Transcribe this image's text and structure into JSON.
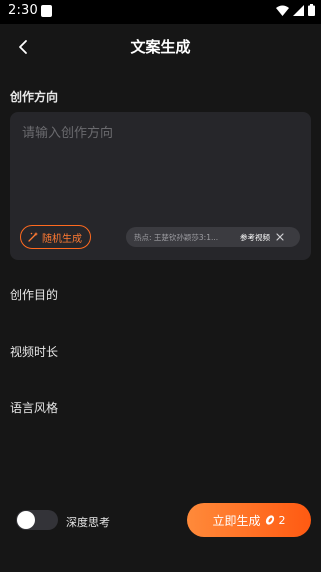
{
  "status": {
    "time": "2:30"
  },
  "header": {
    "title": "文案生成",
    "back_icon": "chevron-left-icon"
  },
  "direction": {
    "label": "创作方向",
    "placeholder": "请输入创作方向",
    "random_button": "随机生成",
    "hot_text": "热点: 王楚钦孙颖莎3:1...",
    "reference_video": "参考视频"
  },
  "fields": {
    "purpose": "创作目的",
    "duration": "视频时长",
    "style": "语言风格"
  },
  "footer": {
    "deep_think_label": "深度思考",
    "deep_think_on": false,
    "generate_label": "立即生成",
    "cost": "2"
  },
  "colors": {
    "accent": "#ff6a1f",
    "background": "#161616",
    "card": "#26262a"
  }
}
